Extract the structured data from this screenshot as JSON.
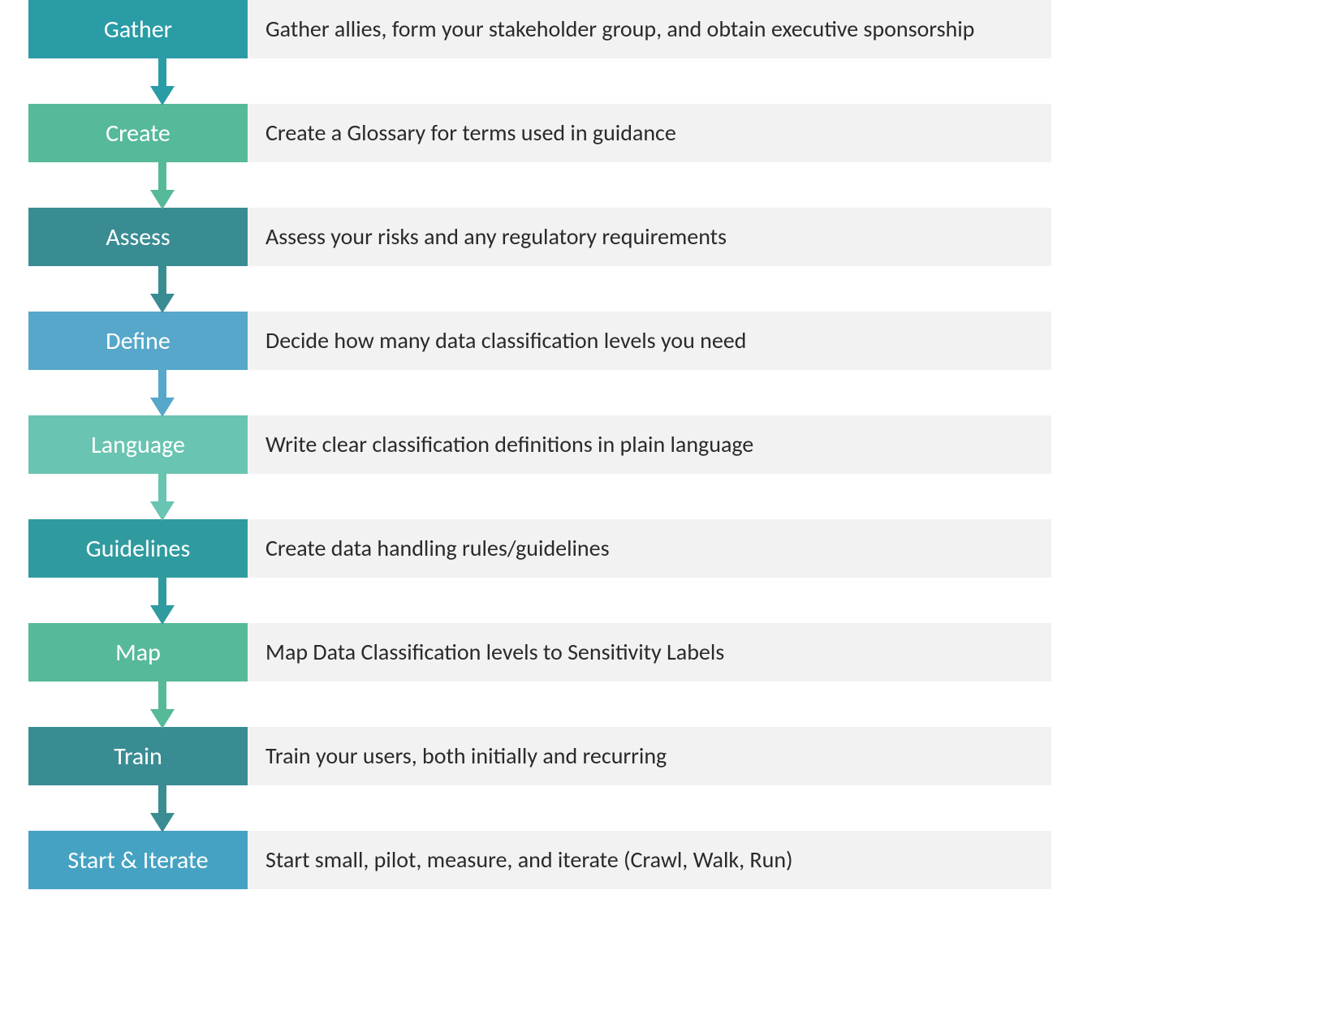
{
  "steps": [
    {
      "label": "Gather",
      "description": "Gather allies, form your stakeholder group, and obtain executive sponsorship",
      "box_color": "#2a9ca6",
      "arrow_color": "#2a9ca6"
    },
    {
      "label": "Create",
      "description": "Create a Glossary for terms used in guidance",
      "box_color": "#56b99a",
      "arrow_color": "#56b99a"
    },
    {
      "label": "Assess",
      "description": "Assess your risks and any regulatory requirements",
      "box_color": "#3a8c93",
      "arrow_color": "#3a8c93"
    },
    {
      "label": "Define",
      "description": "Decide how many data classification levels you need",
      "box_color": "#56a7c9",
      "arrow_color": "#56a7c9"
    },
    {
      "label": "Language",
      "description": "Write clear classification definitions in plain language",
      "box_color": "#69c4b1",
      "arrow_color": "#69c4b1"
    },
    {
      "label": "Guidelines",
      "description": "Create data handling rules/guidelines",
      "box_color": "#2f9b9f",
      "arrow_color": "#2f9b9f"
    },
    {
      "label": "Map",
      "description": "Map Data Classification levels to Sensitivity Labels",
      "box_color": "#56b99a",
      "arrow_color": "#56b99a"
    },
    {
      "label": "Train",
      "description": "Train your users, both initially and recurring",
      "box_color": "#3a8c93",
      "arrow_color": "#3a8c93"
    },
    {
      "label": "Start & Iterate",
      "description": "Start small, pilot, measure, and iterate (Crawl, Walk, Run)",
      "box_color": "#45a2c2",
      "arrow_color": ""
    }
  ]
}
